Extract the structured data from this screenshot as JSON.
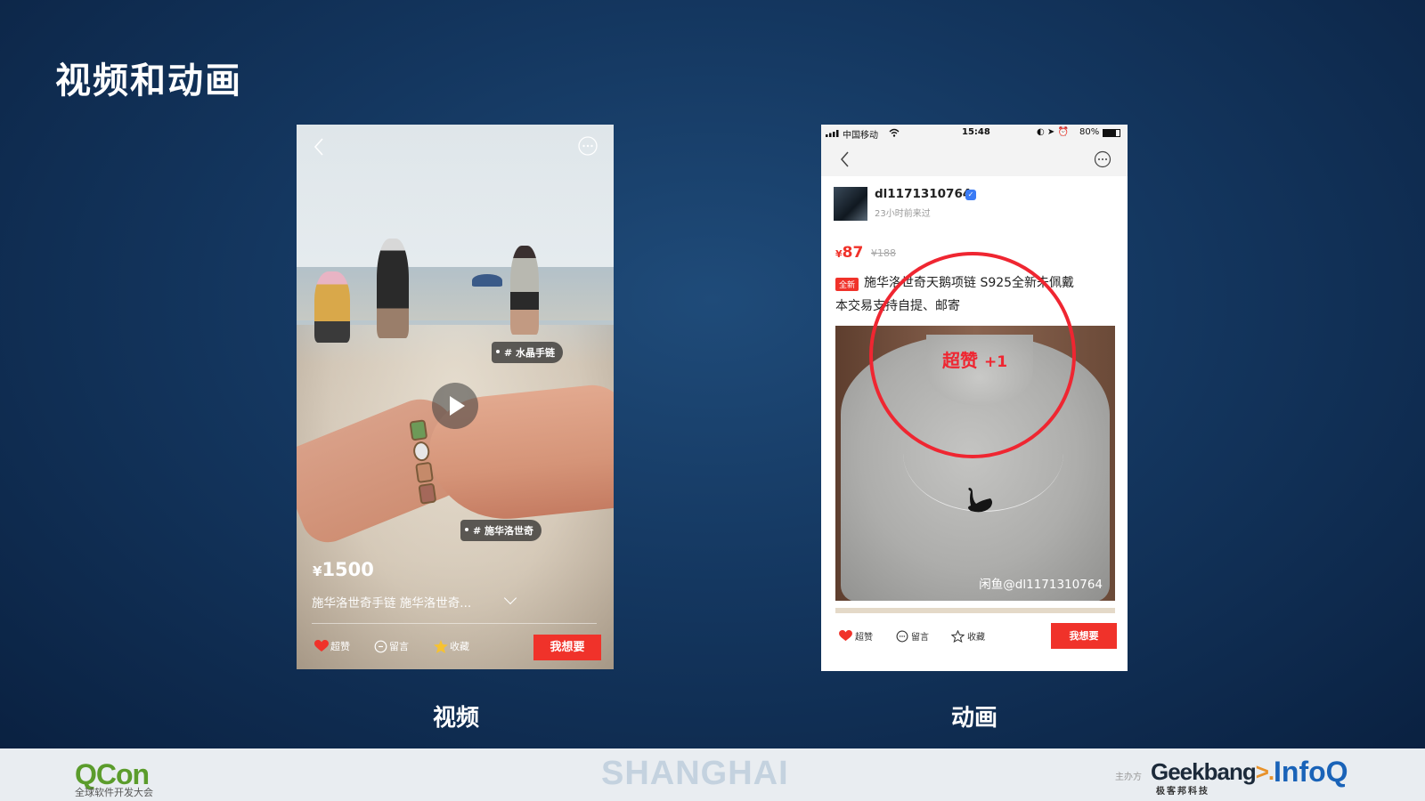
{
  "slide": {
    "title": "视频和动画",
    "caption_left": "视频",
    "caption_right": "动画"
  },
  "video_phone": {
    "tags": [
      "# 水晶手链",
      "# 施华洛世奇"
    ],
    "price_symbol": "¥",
    "price": "1500",
    "description": "施华洛世奇手链 施华洛世奇...",
    "actions": {
      "like": "超赞",
      "comment": "留言",
      "favorite": "收藏"
    },
    "want_button": "我想要",
    "icons": {
      "back": "chevron-left-icon",
      "more": "more-icon",
      "play": "play-icon"
    }
  },
  "animation_phone": {
    "status": {
      "carrier": "中国移动",
      "time": "15:48",
      "battery": "80%"
    },
    "seller": {
      "name": "dl1171310764",
      "last_seen": "23小时前来过"
    },
    "price_symbol": "¥",
    "price": "87",
    "original_price": "¥188",
    "new_badge": "全新",
    "title": "施华洛世奇天鹅项链 S925全新未佩戴",
    "subtitle": "本交易支持自提、邮寄",
    "watermark": "闲鱼@dl1171310764",
    "superlike": {
      "text": "超赞",
      "count": "+1"
    },
    "actions": {
      "like": "超赞",
      "comment": "留言",
      "favorite": "收藏"
    },
    "want_button": "我想要"
  },
  "footer": {
    "qcon_q": "Q",
    "qcon_con": "Con",
    "qcon_sub": "全球软件开发大会",
    "city": "SHANGHAI",
    "host_label": "主办方",
    "geek": "Geekbang",
    "geek_arrow": ">.",
    "geek_sub": "极客邦科技",
    "infoq": "InfoQ"
  },
  "colors": {
    "accent_red": "#f0322a",
    "slide_bg": "#143760",
    "qcon_green": "#5b9c2c",
    "infoq_blue": "#1a63b8"
  }
}
